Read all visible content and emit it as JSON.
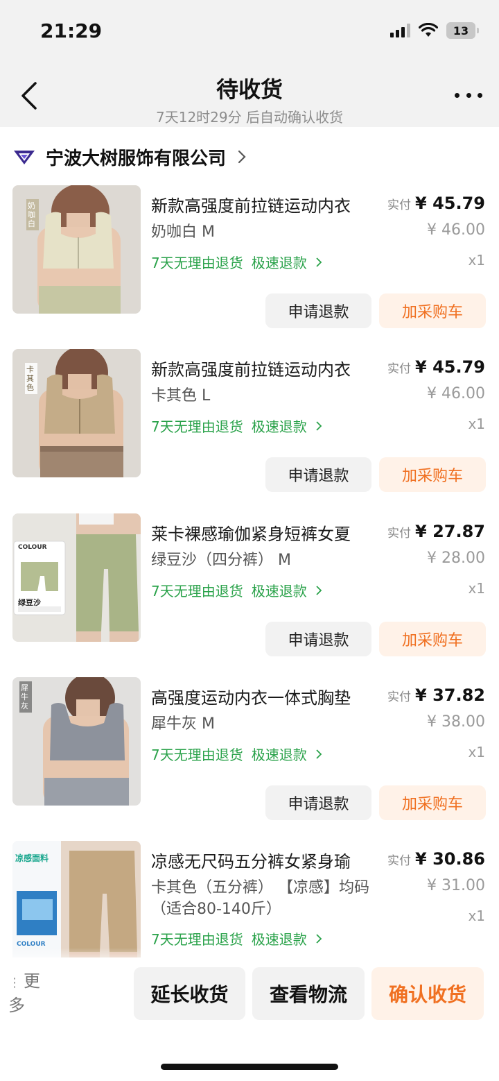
{
  "status_bar": {
    "time": "21:29",
    "battery": "13"
  },
  "nav": {
    "title": "待收货",
    "subtitle": "7天12时29分 后自动确认收货"
  },
  "shop": {
    "name": "宁波大树服饰有限公司"
  },
  "labels": {
    "paid": "实付",
    "refund": "申请退款",
    "add_cart": "加采购车",
    "return_policy": "7天无理由退货",
    "fast_refund": "极速退款"
  },
  "items": [
    {
      "title": "新款高强度前拉链运动内衣",
      "spec": "奶咖白 M",
      "price": "¥ 45.79",
      "original": "¥ 46.00",
      "qty": "x1",
      "image_tag": "奶咖白"
    },
    {
      "title": "新款高强度前拉链运动内衣",
      "spec": "卡其色 L",
      "price": "¥ 45.79",
      "original": "¥ 46.00",
      "qty": "x1",
      "image_tag": "卡其色"
    },
    {
      "title": "莱卡裸感瑜伽紧身短裤女夏",
      "spec": "绿豆沙（四分裤） M",
      "price": "¥ 27.87",
      "original": "¥ 28.00",
      "qty": "x1",
      "image_tag": "绿豆沙",
      "image_badge": "COLOUR"
    },
    {
      "title": "高强度运动内衣一体式胸垫",
      "spec": "犀牛灰 M",
      "price": "¥ 37.82",
      "original": "¥ 38.00",
      "qty": "x1",
      "image_tag": "犀牛灰"
    },
    {
      "title": "凉感无尺码五分裤女紧身瑜",
      "spec": "卡其色（五分裤） 【凉感】均码（适合80-140斤）",
      "price": "¥ 30.86",
      "original": "¥ 31.00",
      "qty": "x1",
      "image_tag": "凉感面料",
      "image_badge": "COLOUR"
    }
  ],
  "bottom": {
    "more": "更多",
    "extend": "延长收货",
    "logistics": "查看物流",
    "confirm": "确认收货"
  },
  "colors": {
    "green": "#2aa24a",
    "orange": "#f07021",
    "orange_bg": "#fff2e8",
    "grey_bg": "#f2f2f2"
  }
}
